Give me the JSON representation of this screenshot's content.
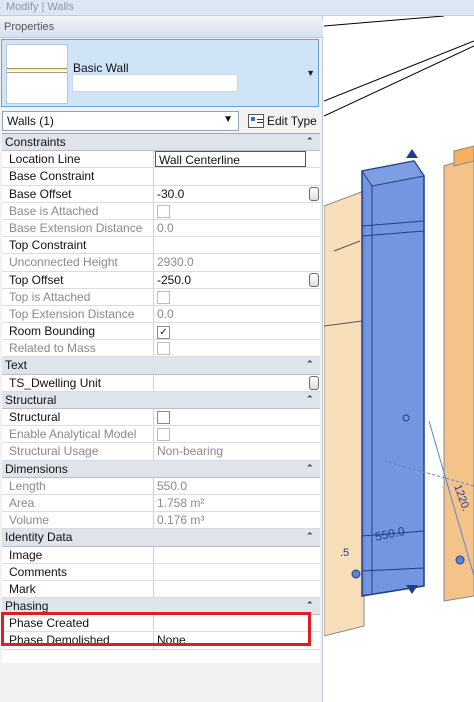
{
  "window": {
    "title": "Modify | Walls"
  },
  "palette": {
    "title": "Properties"
  },
  "type_selector": {
    "family": "Basic Wall",
    "type_name": ""
  },
  "filter": {
    "selected": "Walls (1)",
    "edit_type_label": "Edit Type"
  },
  "groups": [
    {
      "name": "Constraints",
      "rows": [
        {
          "label": "Location Line",
          "value": "Wall Centerline",
          "kind": "boxed"
        },
        {
          "label": "Base Constraint",
          "value": "",
          "kind": "text"
        },
        {
          "label": "Base Offset",
          "value": "-30.0",
          "kind": "knob"
        },
        {
          "label": "Base is Attached",
          "value": "",
          "kind": "checkbox",
          "checked": false,
          "disabled": true
        },
        {
          "label": "Base Extension Distance",
          "value": "0.0",
          "kind": "text",
          "disabled": true
        },
        {
          "label": "Top Constraint",
          "value": "",
          "kind": "text"
        },
        {
          "label": "Unconnected Height",
          "value": "2930.0",
          "kind": "text",
          "disabled": true
        },
        {
          "label": "Top Offset",
          "value": "-250.0",
          "kind": "knob"
        },
        {
          "label": "Top is Attached",
          "value": "",
          "kind": "checkbox",
          "checked": false,
          "disabled": true
        },
        {
          "label": "Top Extension Distance",
          "value": "0.0",
          "kind": "text",
          "disabled": true
        },
        {
          "label": "Room Bounding",
          "value": "",
          "kind": "checkbox",
          "checked": true
        },
        {
          "label": "Related to Mass",
          "value": "",
          "kind": "checkbox",
          "checked": false,
          "disabled": true
        }
      ]
    },
    {
      "name": "Text",
      "rows": [
        {
          "label": "TS_Dwelling Unit",
          "value": "",
          "kind": "knob"
        }
      ]
    },
    {
      "name": "Structural",
      "rows": [
        {
          "label": "Structural",
          "value": "",
          "kind": "checkbox",
          "checked": false
        },
        {
          "label": "Enable Analytical Model",
          "value": "",
          "kind": "checkbox",
          "checked": false,
          "disabled": true
        },
        {
          "label": "Structural Usage",
          "value": "Non-bearing",
          "kind": "text",
          "disabled": true
        }
      ]
    },
    {
      "name": "Dimensions",
      "rows": [
        {
          "label": "Length",
          "value": "550.0",
          "kind": "text",
          "disabled": true
        },
        {
          "label": "Area",
          "value": "1.758 m²",
          "kind": "text",
          "disabled": true
        },
        {
          "label": "Volume",
          "value": "0.176 m³",
          "kind": "text",
          "disabled": true
        }
      ]
    },
    {
      "name": "Identity Data",
      "rows": [
        {
          "label": "Image",
          "value": "",
          "kind": "text"
        },
        {
          "label": "Comments",
          "value": "",
          "kind": "text"
        },
        {
          "label": "Mark",
          "value": "",
          "kind": "text"
        }
      ]
    },
    {
      "name": "Phasing",
      "rows": [
        {
          "label": "Phase Created",
          "value": "",
          "kind": "text"
        },
        {
          "label": "Phase Demolished",
          "value": "None",
          "kind": "text"
        }
      ]
    }
  ],
  "viewport": {
    "dimension_label": "550.0",
    "side_label": "1220.",
    "partial_label": ".5",
    "wall_color": "#5b84d8",
    "highlight_color": "#e01d24"
  }
}
